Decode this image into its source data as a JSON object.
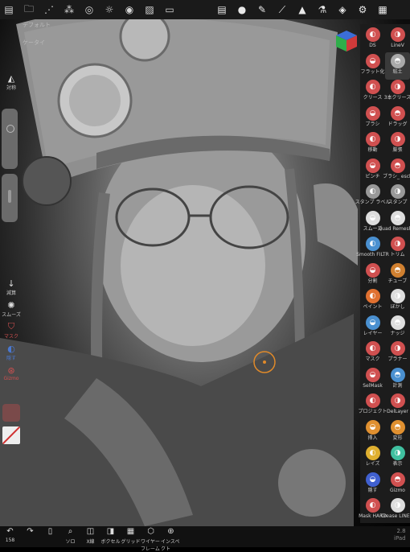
{
  "app": {
    "scene_label": "デフォルト",
    "scene_label2": "ケータイ"
  },
  "topbar": {
    "icons": [
      "sidebar-icon",
      "folder-icon",
      "share-icon",
      "layers-icon",
      "grid-icon",
      "light-icon",
      "matcap-icon",
      "image-icon",
      "camera-icon"
    ],
    "right_icons": [
      "stack-icon",
      "sphere-icon",
      "pen-icon",
      "pipette-icon",
      "triangle-icon",
      "flask-icon",
      "layers-icon",
      "settings-icon",
      "grid-icon"
    ]
  },
  "left": {
    "sym_label": "対称",
    "reduce_label": "減算",
    "smooth_label": "スムーズ",
    "mask_label": "マスク",
    "hide_label": "隠す",
    "gizmo_label": "Gizmo"
  },
  "tools": [
    {
      "label": "DS",
      "color": "#d05050"
    },
    {
      "label": "LineV",
      "color": "#d05050"
    },
    {
      "label": "フラット化",
      "color": "#d05050"
    },
    {
      "label": "粘土",
      "color": "#aaaaaa",
      "active": true
    },
    {
      "label": "クリース",
      "color": "#d05050"
    },
    {
      "label": "3本クリース",
      "color": "#d05050"
    },
    {
      "label": "ブラシ",
      "color": "#d05050"
    },
    {
      "label": "ドラッグ",
      "color": "#d05050"
    },
    {
      "label": "移動",
      "color": "#d05050"
    },
    {
      "label": "膨張",
      "color": "#d05050"
    },
    {
      "label": "ピンチ",
      "color": "#d05050"
    },
    {
      "label": "ブラシ_ esch",
      "color": "#d05050"
    },
    {
      "label": "スタンプ ラベル",
      "color": "#999999"
    },
    {
      "label": "スタンプ",
      "color": "#999999"
    },
    {
      "label": "スムーズ",
      "color": "#dddddd"
    },
    {
      "label": "Quad Remesher",
      "color": "#dddddd"
    },
    {
      "label": "Smooth FILTR",
      "color": "#4a90d0"
    },
    {
      "label": "トリム",
      "color": "#d05050"
    },
    {
      "label": "分割",
      "color": "#d05050"
    },
    {
      "label": "チューブ",
      "color": "#d08030"
    },
    {
      "label": "ペイント",
      "color": "#e07030"
    },
    {
      "label": "ぼかし",
      "color": "#dddddd"
    },
    {
      "label": "レイヤー",
      "color": "#4a90d0"
    },
    {
      "label": "ナッジ",
      "color": "#dddddd"
    },
    {
      "label": "マスク",
      "color": "#d05050"
    },
    {
      "label": "プラナー",
      "color": "#d05050"
    },
    {
      "label": "SelMask",
      "color": "#d05050"
    },
    {
      "label": "計測",
      "color": "#4a90d0"
    },
    {
      "label": "プロジェクト",
      "color": "#d05050"
    },
    {
      "label": "DelLayer",
      "color": "#d05050"
    },
    {
      "label": "挿入",
      "color": "#e09030"
    },
    {
      "label": "変形",
      "color": "#e09030"
    },
    {
      "label": "レイズ",
      "color": "#e0b030"
    },
    {
      "label": "表示",
      "color": "#40c0a0"
    },
    {
      "label": "隠す",
      "color": "#4060d0"
    },
    {
      "label": "Gizmo",
      "color": "#d05050"
    },
    {
      "label": "Mask HARD",
      "color": "#d05050"
    },
    {
      "label": "Crease LINE 2",
      "color": "#dddddd"
    }
  ],
  "bottom": [
    {
      "label": "158",
      "icon": "undo-icon"
    },
    {
      "label": "",
      "icon": "redo-icon"
    },
    {
      "label": "",
      "icon": "phone-icon"
    },
    {
      "label": "ソロ",
      "icon": "search-icon"
    },
    {
      "label": "X線",
      "icon": "xray-icon"
    },
    {
      "label": "ボクセル",
      "icon": "voxel-icon"
    },
    {
      "label": "グリッド",
      "icon": "grid-icon"
    },
    {
      "label": "ワイヤーフレーム",
      "icon": "wireframe-icon"
    },
    {
      "label": "インスペクト",
      "icon": "inspect-icon"
    }
  ],
  "version": {
    "number": "2.8",
    "device": "iPad"
  }
}
